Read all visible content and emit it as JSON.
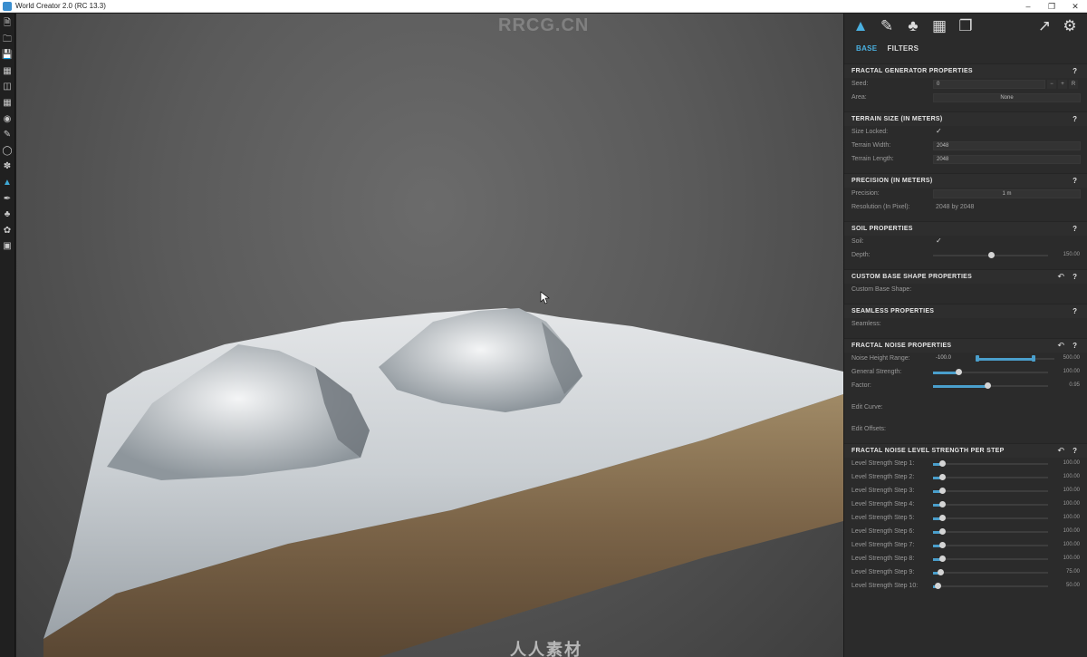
{
  "window": {
    "title": "World Creator 2.0 (RC 13.3)",
    "controls": [
      "–",
      "❐",
      "✕"
    ]
  },
  "toolbar": {
    "icons": [
      "new-file-icon",
      "open-folder-icon",
      "save-icon",
      "save-as-icon",
      "map-icon",
      "terrain-map-icon",
      "binoculars-icon",
      "brush-tool-icon",
      "globe-icon",
      "gear-flower-icon",
      "mountain-icon",
      "pen-icon",
      "forest-icon",
      "grass-icon",
      "camera-icon"
    ],
    "active_index": 10
  },
  "viewport": {
    "watermark_top": "RRCG.CN",
    "watermark_bottom": "人人素材"
  },
  "panel": {
    "tabs": [
      {
        "label": "BASE",
        "active": true
      },
      {
        "label": "FILTERS",
        "active": false
      }
    ],
    "fractal_generator": {
      "title": "FRACTAL GENERATOR PROPERTIES",
      "seed_label": "Seed:",
      "seed_value": "0",
      "area_label": "Area:",
      "area_value": "None"
    },
    "terrain_size": {
      "title": "TERRAIN SIZE (IN METERS)",
      "size_locked_label": "Size Locked:",
      "size_locked": "✓",
      "width_label": "Terrain Width:",
      "width_value": "2048",
      "length_label": "Terrain Length:",
      "length_value": "2048"
    },
    "precision": {
      "title": "PRECISION (IN METERS)",
      "precision_label": "Precision:",
      "precision_value": "1 m",
      "resolution_label": "Resolution (In Pixel):",
      "resolution_value": "2048 by 2048"
    },
    "soil": {
      "title": "SOIL PROPERTIES",
      "soil_label": "Soil:",
      "soil_checked": "✓",
      "depth_label": "Depth:",
      "depth_value": "150.00",
      "depth_fraction": 0.5
    },
    "custom_base_shape": {
      "title": "CUSTOM BASE SHAPE PROPERTIES",
      "label": "Custom Base Shape:"
    },
    "seamless": {
      "title": "SEAMLESS PROPERTIES",
      "label": "Seamless:"
    },
    "fractal_noise": {
      "title": "FRACTAL NOISE PROPERTIES",
      "height_range_label": "Noise Height Range:",
      "height_range_min": "-100.0",
      "height_range_max": "500.00",
      "strength_label": "General Strength:",
      "strength_value": "100.00",
      "strength_fraction": 0.22,
      "factor_label": "Factor:",
      "factor_value": "0.95",
      "factor_fraction": 0.47,
      "edit_curve_label": "Edit Curve:",
      "edit_offsets_label": "Edit Offsets:"
    },
    "level_strength": {
      "title": "FRACTAL NOISE LEVEL STRENGTH PER STEP",
      "steps": [
        {
          "label": "Level Strength Step 1:",
          "value": "100.00",
          "fraction": 0.08
        },
        {
          "label": "Level Strength Step 2:",
          "value": "100.00",
          "fraction": 0.08
        },
        {
          "label": "Level Strength Step 3:",
          "value": "100.00",
          "fraction": 0.08
        },
        {
          "label": "Level Strength Step 4:",
          "value": "100.00",
          "fraction": 0.08
        },
        {
          "label": "Level Strength Step 5:",
          "value": "100.00",
          "fraction": 0.08
        },
        {
          "label": "Level Strength Step 6:",
          "value": "100.00",
          "fraction": 0.08
        },
        {
          "label": "Level Strength Step 7:",
          "value": "100.00",
          "fraction": 0.08
        },
        {
          "label": "Level Strength Step 8:",
          "value": "100.00",
          "fraction": 0.08
        },
        {
          "label": "Level Strength Step 9:",
          "value": "75.00",
          "fraction": 0.06
        },
        {
          "label": "Level Strength Step 10:",
          "value": "50.00",
          "fraction": 0.04
        }
      ]
    },
    "help_glyph": "?",
    "reset_glyph": "↶"
  },
  "colors": {
    "accent": "#4ab0e0",
    "panel_bg": "#2b2b2b",
    "slider_fill": "#4a9fcc"
  }
}
